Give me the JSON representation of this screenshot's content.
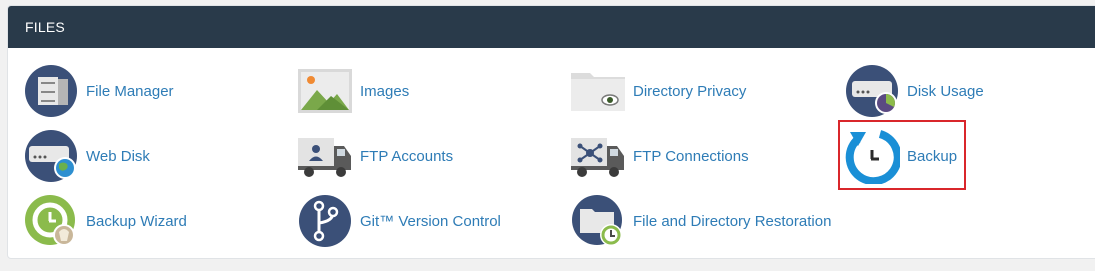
{
  "panel": {
    "title": "FILES"
  },
  "items": [
    {
      "label": "File Manager",
      "icon": "file-manager-icon"
    },
    {
      "label": "Images",
      "icon": "images-icon"
    },
    {
      "label": "Directory Privacy",
      "icon": "directory-privacy-icon"
    },
    {
      "label": "Disk Usage",
      "icon": "disk-usage-icon"
    },
    {
      "label": "Web Disk",
      "icon": "web-disk-icon"
    },
    {
      "label": "FTP Accounts",
      "icon": "ftp-accounts-icon"
    },
    {
      "label": "FTP Connections",
      "icon": "ftp-connections-icon"
    },
    {
      "label": "Backup",
      "icon": "backup-icon"
    },
    {
      "label": "Backup Wizard",
      "icon": "backup-wizard-icon"
    },
    {
      "label": "Git™ Version Control",
      "icon": "git-version-control-icon"
    },
    {
      "label": "File and Directory Restoration",
      "icon": "file-directory-restoration-icon"
    }
  ],
  "colors": {
    "header_bg": "#293a4a",
    "link": "#2e7cb6",
    "highlight": "#d9262b",
    "icon_navy": "#3b5078",
    "icon_blue": "#1a8fd6"
  }
}
